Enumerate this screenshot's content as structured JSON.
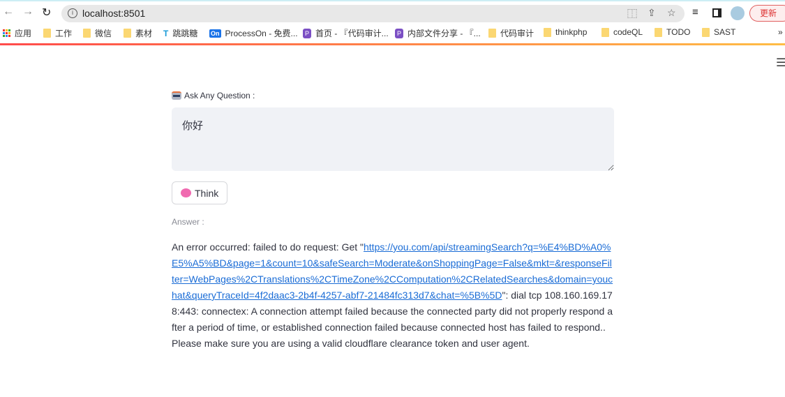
{
  "browser": {
    "url": "localhost:8501",
    "update_label": "更新",
    "bookmarks": [
      {
        "label": "应用",
        "icon": "apps-icon"
      },
      {
        "label": "工作",
        "icon": "folder-icon"
      },
      {
        "label": "微信",
        "icon": "folder-icon"
      },
      {
        "label": "素材",
        "icon": "folder-icon"
      },
      {
        "label": "跳跳糖",
        "icon": "site-icon"
      },
      {
        "label": "ProcessOn - 免费...",
        "icon": "processon-icon"
      },
      {
        "label": "首页 - 『代码审计...",
        "icon": "p-icon"
      },
      {
        "label": "内部文件分享 - 『...",
        "icon": "p-icon"
      },
      {
        "label": "代码审计",
        "icon": "folder-icon"
      },
      {
        "label": "thinkphp",
        "icon": "folder-icon"
      },
      {
        "label": "codeQL",
        "icon": "folder-icon"
      },
      {
        "label": "TODO",
        "icon": "folder-icon"
      },
      {
        "label": "SAST",
        "icon": "folder-icon"
      }
    ],
    "more_bookmarks": "»"
  },
  "app": {
    "question_label": "Ask Any Question :",
    "question_value": "你好",
    "think_button": "Think",
    "answer_label": "Answer :",
    "answer_prefix": "An error occurred: failed to do request: Get \"",
    "answer_link": "https://you.com/api/streamingSearch?q=%E4%BD%A0%E5%A5%BD&page=1&count=10&safeSearch=Moderate&onShoppingPage=False&mkt=&responseFilter=WebPages%2CTranslations%2CTimeZone%2CComputation%2CRelatedSearches&domain=youchat&queryTraceId=4f2daac3-2b4f-4257-abf7-21484fc313d7&chat=%5B%5D",
    "answer_suffix": "\": dial tcp 108.160.169.178:443: connectex: A connection attempt failed because the connected party did not properly respond after a period of time, or established connection failed because connected host has failed to respond.. Please make sure you are using a valid cloudflare clearance token and user agent."
  },
  "colors": {
    "accent": "#ff4b4b",
    "link": "#1a6cd6",
    "input_bg": "#f0f2f6"
  }
}
